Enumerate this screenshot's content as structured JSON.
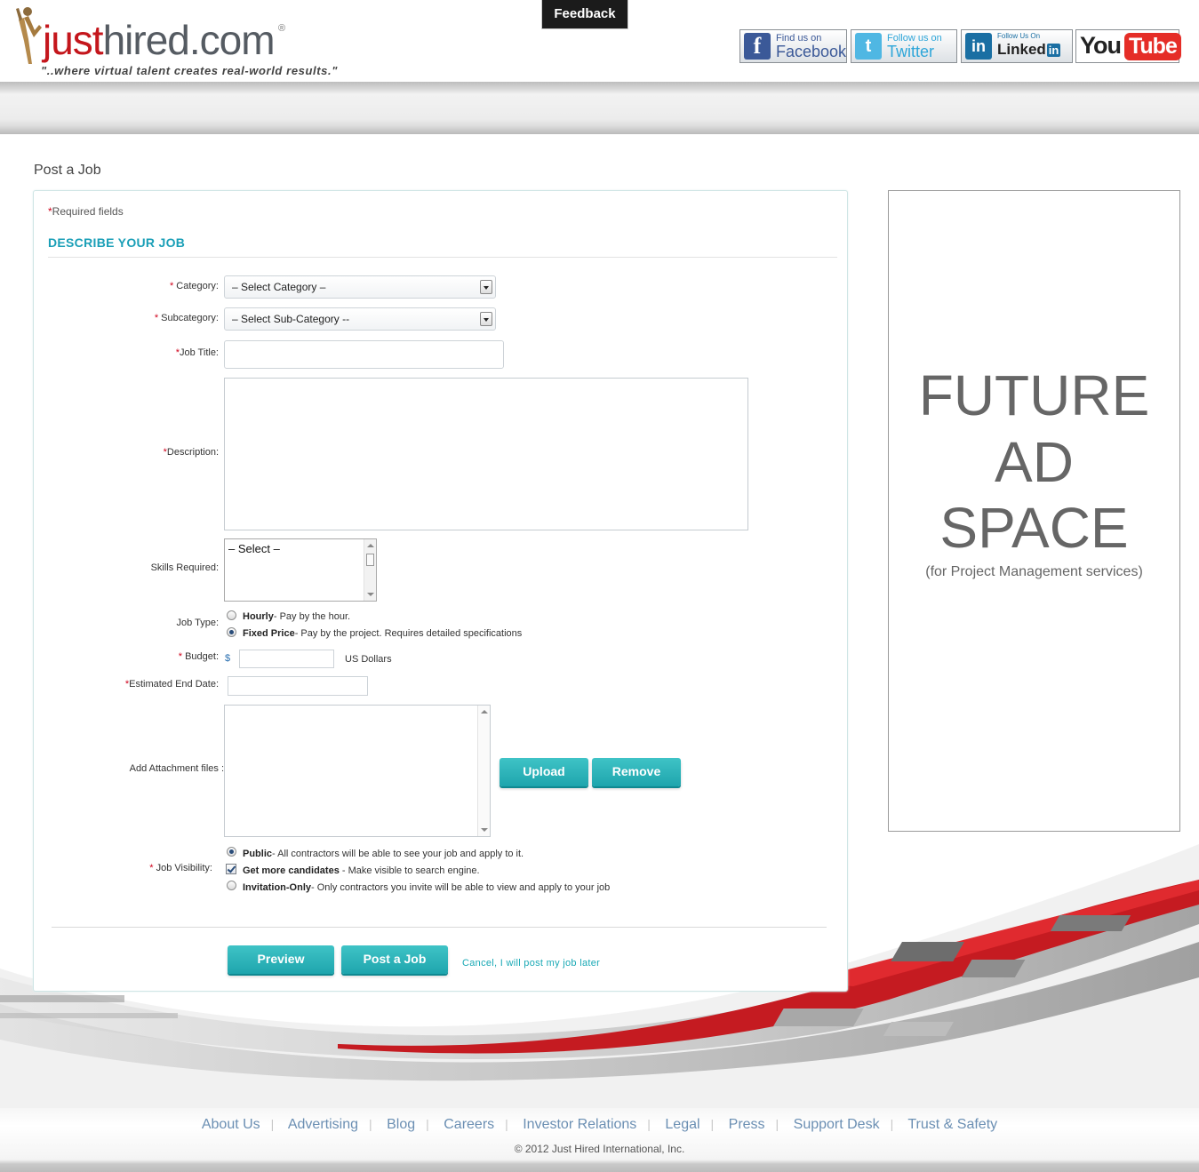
{
  "header": {
    "logo_just": "just",
    "logo_hired": "hired.com",
    "logo_reg": "®",
    "tagline": "\"..where virtual talent creates real-world results.\"",
    "feedback": "Feedback",
    "social": {
      "facebook": {
        "line1": "Find us on",
        "line2": "Facebook",
        "glyph": "f"
      },
      "twitter": {
        "line1": "Follow us on",
        "line2": "Twitter",
        "glyph": "t"
      },
      "linkedin": {
        "line1": "Follow Us On",
        "line2": "Linked",
        "badge": "in",
        "glyph": "in"
      },
      "youtube": {
        "you": "You",
        "tube": "Tube"
      }
    }
  },
  "page": {
    "title": "Post a Job"
  },
  "form": {
    "required_star": "*",
    "required_note": "Required fields",
    "section_title": "DESCRIBE YOUR JOB",
    "category": {
      "label": "Category:",
      "value": "– Select Category –"
    },
    "subcategory": {
      "label": "Subcategory:",
      "value": "– Select Sub-Category --"
    },
    "job_title": {
      "label": "Job Title:",
      "value": ""
    },
    "description": {
      "label": "Description:",
      "value": ""
    },
    "skills": {
      "label": "Skills Required:",
      "first_option": "– Select –"
    },
    "job_type": {
      "label": "Job Type:",
      "options": [
        {
          "title": "Hourly",
          "desc": "- Pay by the hour.",
          "selected": false
        },
        {
          "title": "Fixed Price",
          "desc": "- Pay by the project. Requires detailed specifications",
          "selected": true
        }
      ]
    },
    "budget": {
      "label": "Budget:",
      "currency": "$",
      "value": "",
      "unit": "US Dollars"
    },
    "end_date": {
      "label": "Estimated End Date:",
      "value": ""
    },
    "attachments": {
      "label": "Add Attachment files :",
      "upload": "Upload",
      "remove": "Remove"
    },
    "visibility": {
      "label": "Job Visibility:",
      "public": {
        "title": "Public",
        "desc": "- All contractors will be able to see your job and apply to it.",
        "selected": true
      },
      "more": {
        "title": "Get more candidates",
        "desc": " - Make visible to search engine.",
        "checked": true
      },
      "invite": {
        "title": "Invitation-Only",
        "desc": "- Only contractors you invite will be able to view and apply to your job",
        "selected": false
      }
    },
    "actions": {
      "preview": "Preview",
      "post": "Post a Job",
      "cancel": "Cancel, I will post my job later"
    }
  },
  "ad": {
    "line1": "FUTURE",
    "line2": "AD",
    "line3": "SPACE",
    "sub": "(for Project Management services)"
  },
  "footer": {
    "links": [
      "About Us",
      "Advertising",
      "Blog",
      "Careers",
      "Investor Relations",
      "Legal",
      "Press",
      "Support Desk",
      "Trust & Safety"
    ],
    "copyright": "© 2012 Just Hired International, Inc."
  },
  "colors": {
    "accent_teal": "#1ea5ad",
    "section_blue": "#1a9fb7",
    "brand_red": "#c4161c",
    "required_red": "#d0021b"
  }
}
